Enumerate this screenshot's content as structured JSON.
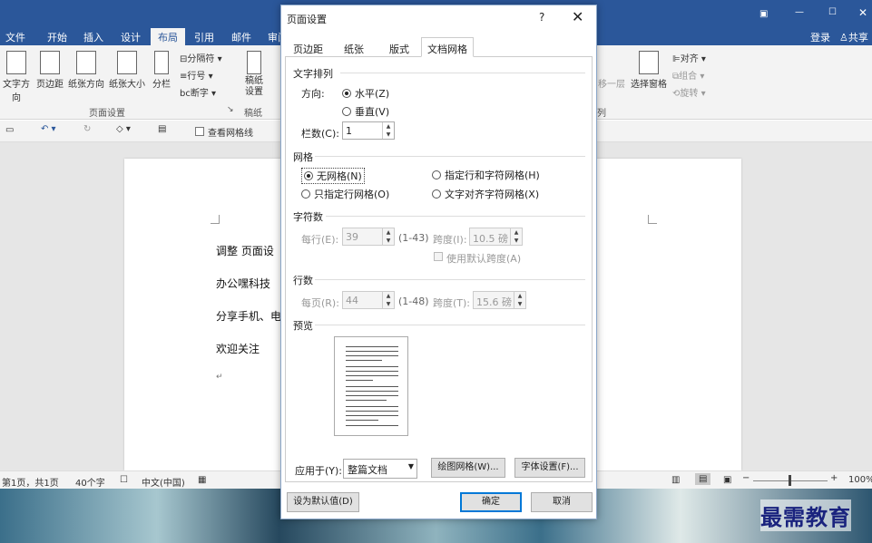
{
  "word": {
    "tabs": [
      "文件",
      "开始",
      "插入",
      "设计",
      "布局",
      "引用",
      "邮件",
      "审阅"
    ],
    "active_tab": "布局",
    "signin": "登录",
    "share": "共享",
    "ribbon_buttons": [
      "文字方向",
      "页边距",
      "纸张方向",
      "纸张大小",
      "分栏",
      "稿纸设置"
    ],
    "ribbon_small": [
      "分隔符",
      "行号",
      "断字"
    ],
    "ribbon_right": [
      "对齐",
      "组合",
      "旋转",
      "移一层",
      "选择窗格"
    ],
    "group_labels": [
      "页面设置",
      "稿纸",
      "列"
    ],
    "qat_checkbox": "查看网格线",
    "doc_lines": [
      "调整 页面设",
      "办公嘿科技",
      "分享手机、电",
      "欢迎关注"
    ],
    "status": {
      "page": "第1页，共1页",
      "words": "40个字",
      "lang": "中文(中国)",
      "zoom": "100%"
    }
  },
  "dialog": {
    "title": "页面设置",
    "help": "?",
    "tabs": [
      "页边距",
      "纸张",
      "版式",
      "文档网格"
    ],
    "active_tab": "文档网格",
    "sections": {
      "text_direction": "文字排列",
      "grid": "网格",
      "chars": "字符数",
      "lines": "行数",
      "preview": "预览"
    },
    "direction_label": "方向:",
    "horizontal": "水平(Z)",
    "vertical": "垂直(V)",
    "columns_label": "栏数(C):",
    "columns_value": "1",
    "grid_options": [
      "无网格(N)",
      "指定行和字符网格(H)",
      "只指定行网格(O)",
      "文字对齐字符网格(X)"
    ],
    "selected_grid": "无网格(N)",
    "chars_per_line_label": "每行(E):",
    "chars_per_line_value": "39",
    "chars_range": "(1-43)",
    "char_pitch_label": "跨度(I):",
    "char_pitch_value": "10.5 磅",
    "use_default_pitch": "使用默认跨度(A)",
    "lines_per_page_label": "每页(R):",
    "lines_per_page_value": "44",
    "lines_range": "(1-48)",
    "line_pitch_label": "跨度(T):",
    "line_pitch_value": "15.6 磅",
    "apply_label": "应用于(Y):",
    "apply_value": "整篇文档",
    "draw_grid_btn": "绘图网格(W)...",
    "font_settings_btn": "字体设置(F)...",
    "default_btn": "设为默认值(D)",
    "ok_btn": "确定",
    "cancel_btn": "取消"
  },
  "watermark": "最需教育"
}
